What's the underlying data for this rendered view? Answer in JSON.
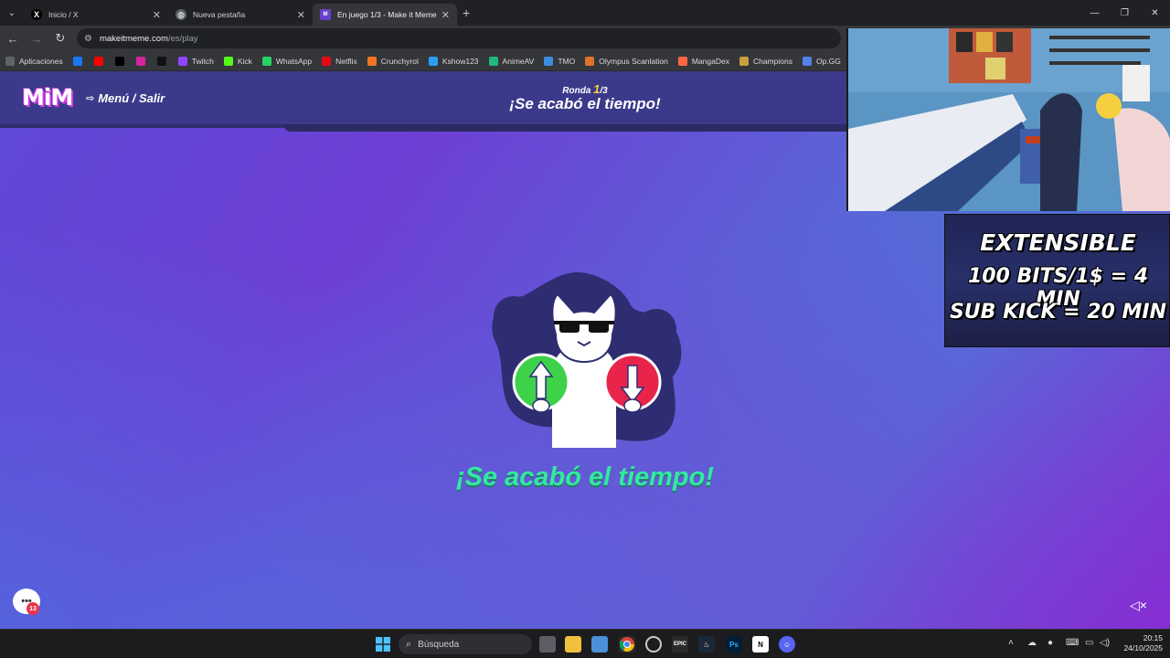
{
  "browser": {
    "tabs": [
      {
        "title": "Inicio / X",
        "icon": "x-logo-icon",
        "active": false
      },
      {
        "title": "Nueva pestaña",
        "icon": "globe-icon",
        "active": false
      },
      {
        "title": "En juego 1/3 - Make it Meme",
        "icon": "mim-logo-icon",
        "active": true
      }
    ],
    "url_host": "makeitmeme.com",
    "url_path": "/es/play",
    "bookmarks": [
      {
        "label": "Aplicaciones",
        "icon": "apps-grid-icon",
        "color": "#5f6368"
      },
      {
        "label": "",
        "icon": "facebook-icon",
        "color": "#1877f2"
      },
      {
        "label": "",
        "icon": "youtube-icon",
        "color": "#ff0000"
      },
      {
        "label": "",
        "icon": "x-icon",
        "color": "#000000"
      },
      {
        "label": "",
        "icon": "instagram-icon",
        "color": "#d6249f"
      },
      {
        "label": "",
        "icon": "tiktok-icon",
        "color": "#111111"
      },
      {
        "label": "Twitch",
        "icon": "twitch-icon",
        "color": "#9146ff"
      },
      {
        "label": "Kick",
        "icon": "kick-icon",
        "color": "#53fc18"
      },
      {
        "label": "WhatsApp",
        "icon": "whatsapp-icon",
        "color": "#25d366"
      },
      {
        "label": "Netflix",
        "icon": "netflix-icon",
        "color": "#e50914"
      },
      {
        "label": "Crunchyrol",
        "icon": "crunchyroll-icon",
        "color": "#f47521"
      },
      {
        "label": "Kshow123",
        "icon": "kshow-icon",
        "color": "#2a9df4"
      },
      {
        "label": "AnimeAV",
        "icon": "animeav-icon",
        "color": "#1fb87a"
      },
      {
        "label": "TMO",
        "icon": "tmo-icon",
        "color": "#3a8dde"
      },
      {
        "label": "Olympus Scanlation",
        "icon": "olympus-icon",
        "color": "#e0732c"
      },
      {
        "label": "MangaDex",
        "icon": "mangadex-icon",
        "color": "#ff6740"
      },
      {
        "label": "Champions",
        "icon": "champions-icon",
        "color": "#c8a13c"
      },
      {
        "label": "Op.GG",
        "icon": "opgg-icon",
        "color": "#5383e8"
      }
    ]
  },
  "game": {
    "logo": "MiM",
    "menu_label": "Menú / Salir",
    "round_label": "Ronda",
    "round_current": "1",
    "round_total": "/3",
    "header_title": "¡Se acabó el tiempo!",
    "timeout_message": "¡Se acabó el tiempo!",
    "chat_badge": "13",
    "colors": {
      "accent_green": "#34e8a2",
      "upvote": "#3ed14a",
      "downvote": "#e8244a"
    }
  },
  "stream_overlay": {
    "line1": "EXTENSIBLE",
    "line2": "100 BITS/1$ = 4 MIN",
    "line3": "SUB KICK = 20 MIN"
  },
  "taskbar": {
    "search_placeholder": "Búsqueda",
    "time": "20:15",
    "date": "24/10/2025"
  }
}
